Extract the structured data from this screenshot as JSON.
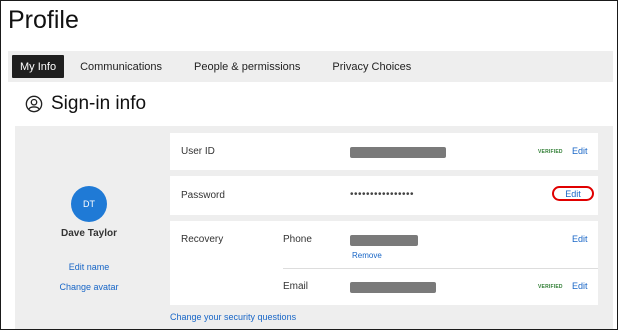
{
  "page": {
    "title": "Profile"
  },
  "tabs": [
    {
      "label": "My Info",
      "active": true
    },
    {
      "label": "Communications",
      "active": false
    },
    {
      "label": "People & permissions",
      "active": false
    },
    {
      "label": "Privacy Choices",
      "active": false
    }
  ],
  "section": {
    "title": "Sign-in info",
    "icon": "user-circle-icon"
  },
  "profile": {
    "initials": "DT",
    "name": "Dave Taylor",
    "edit_name": "Edit name",
    "change_avatar": "Change avatar",
    "avatar_color": "#1f7ad6"
  },
  "user_id": {
    "label": "User ID",
    "status": "VERIFIED",
    "edit": "Edit"
  },
  "password": {
    "label": "Password",
    "masked": "••••••••••••••••",
    "edit": "Edit"
  },
  "recovery": {
    "label": "Recovery",
    "phone": {
      "label": "Phone",
      "remove": "Remove",
      "edit": "Edit"
    },
    "email": {
      "label": "Email",
      "status": "VERIFIED",
      "edit": "Edit"
    }
  },
  "security_link": "Change your security questions",
  "colors": {
    "link": "#1866c7",
    "verified": "#2e7d32",
    "highlight": "#e00000",
    "active_tab": "#1f1f1f"
  }
}
